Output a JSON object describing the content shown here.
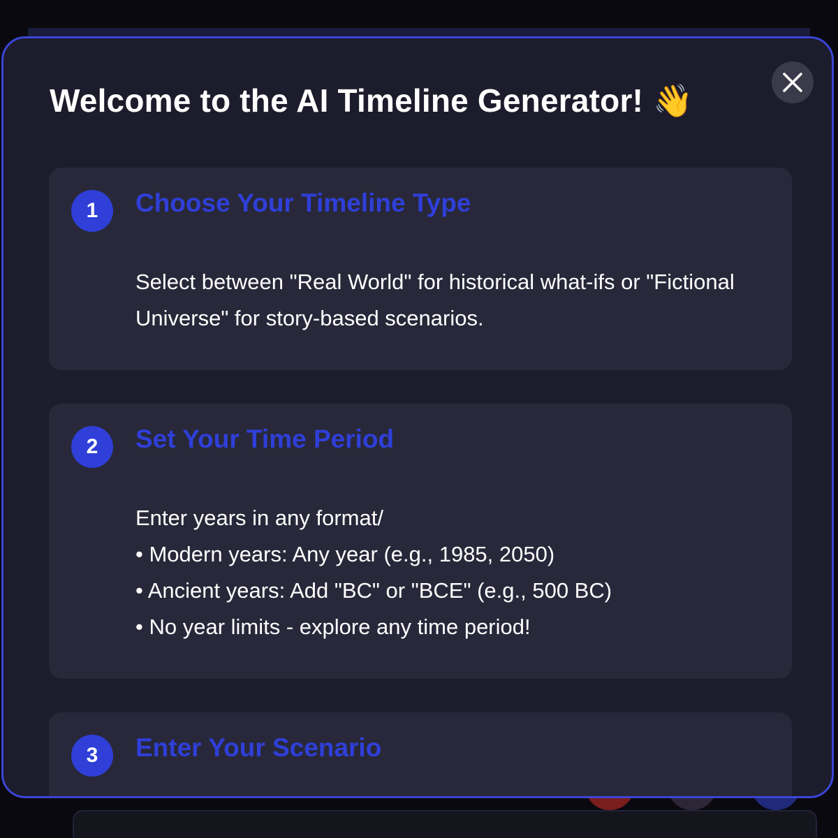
{
  "modal": {
    "title": "Welcome to the AI Timeline Generator!",
    "title_emoji": "👋",
    "close_icon": "close-icon"
  },
  "steps": [
    {
      "number": "1",
      "title": "Choose Your Timeline Type",
      "description": "Select between \"Real World\" for historical what-ifs or \"Fictional Universe\" for story-based scenarios."
    },
    {
      "number": "2",
      "title": "Set Your Time Period",
      "lines": [
        "Enter years in any format/",
        "• Modern years: Any year (e.g., 1985, 2050)",
        "• Ancient years: Add \"BC\" or \"BCE\" (e.g., 500 BC)",
        "• No year limits - explore any time period!"
      ]
    },
    {
      "number": "3",
      "title": "Enter Your Scenario"
    }
  ],
  "colors": {
    "accent": "#2f3fd8",
    "modal_border": "#3b45d6",
    "modal_bg": "#1c1c2c",
    "card_bg": "#28283a"
  }
}
